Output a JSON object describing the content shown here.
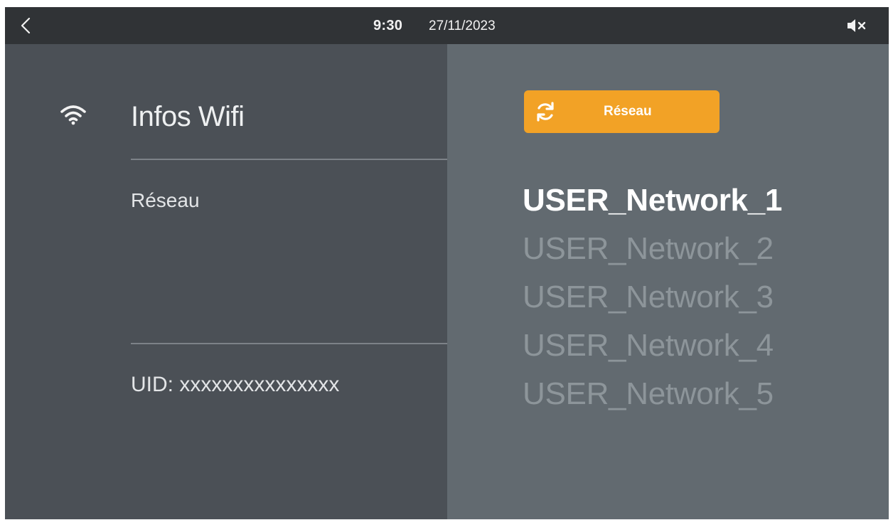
{
  "status_bar": {
    "time": "9:30",
    "date": "27/11/2023",
    "back_icon": "chevron-left-icon",
    "mute_icon": "speaker-muted-icon"
  },
  "left_panel": {
    "icon": "wifi-icon",
    "title": "Infos Wifi",
    "network_label": "Réseau",
    "uid_label": "UID: xxxxxxxxxxxxxxx"
  },
  "right_panel": {
    "refresh_button": {
      "label": "Réseau",
      "icon": "refresh-icon",
      "color": "#f2a226"
    },
    "networks": [
      {
        "name": "USER_Network_1",
        "selected": true
      },
      {
        "name": "USER_Network_2",
        "selected": false
      },
      {
        "name": "USER_Network_3",
        "selected": false
      },
      {
        "name": "USER_Network_4",
        "selected": false
      },
      {
        "name": "USER_Network_5",
        "selected": false
      }
    ]
  },
  "colors": {
    "status_bar_bg": "#303336",
    "left_panel_bg": "#4b5056",
    "right_panel_bg": "#626a70",
    "selected_text": "#ffffff",
    "unselected_text": "#8d959a"
  }
}
